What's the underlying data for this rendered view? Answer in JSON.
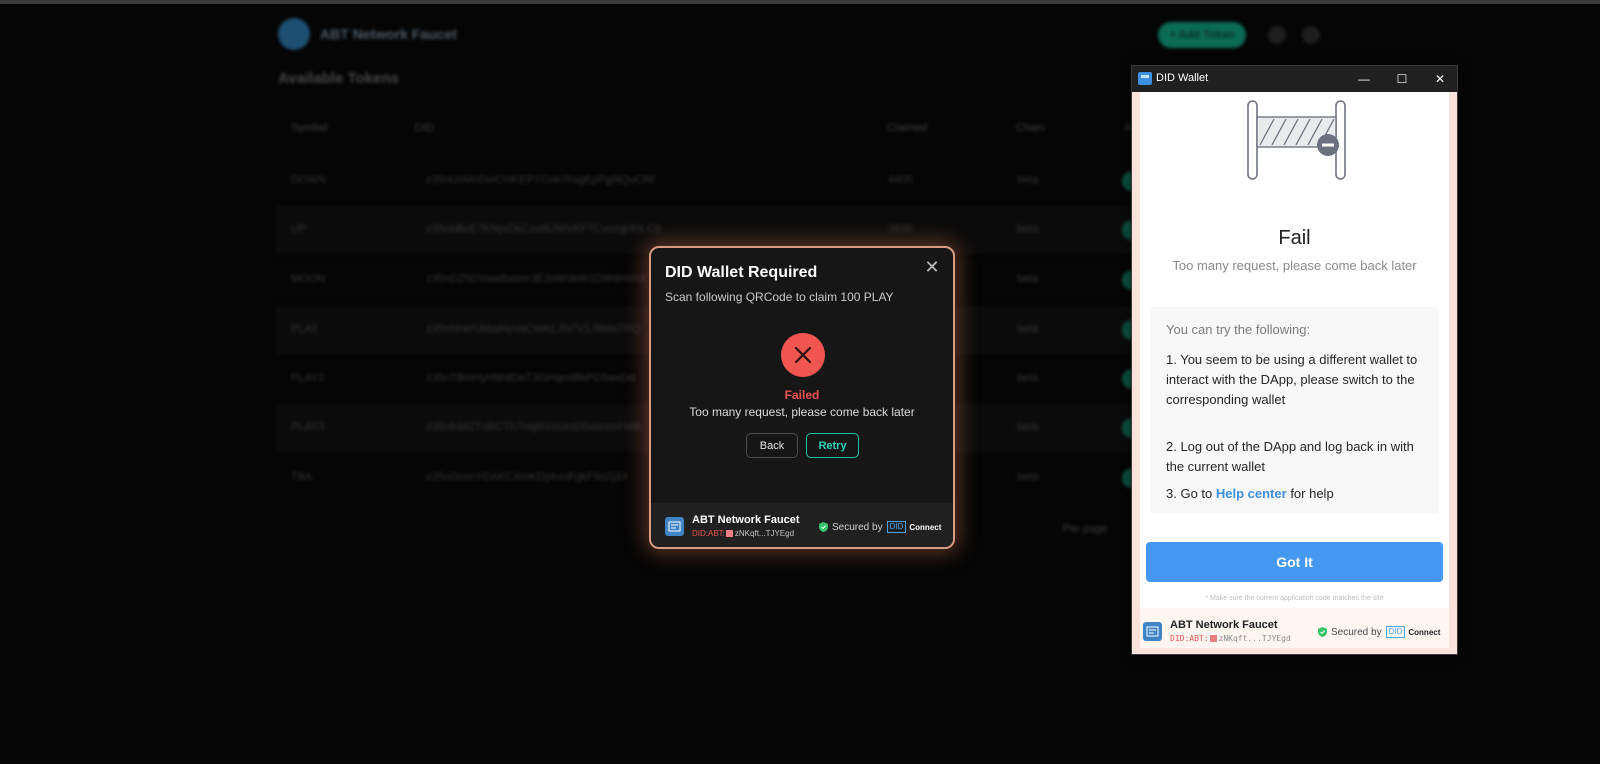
{
  "background_app": {
    "title": "ABT Network Faucet",
    "add_button": "+ Add Token",
    "section_title": "Available Tokens",
    "columns": [
      "Symbol",
      "DID",
      "Claimed",
      "Chain",
      "A"
    ],
    "rows": [
      {
        "symbol": "DOWN",
        "did": "z35nUxMnDvrCHKEPYCnk7hsgEpPg6tQuCRf",
        "claimed": "4405",
        "chain": "beta"
      },
      {
        "symbol": "UP",
        "did": "z35nbBeE7KNprDkCzwBJWVKF7CvozgHHLC9",
        "claimed": "2835",
        "chain": "beta"
      },
      {
        "symbol": "MOON",
        "did": "z35nDZ5DVwe8xomrJEJoWVeW1D9htHXhX",
        "claimed": "",
        "chain": "beta"
      },
      {
        "symbol": "PLAY",
        "did": "z35nNnerUkbaNyVaCWKLJN7V1J9MaTRQ",
        "claimed": "",
        "chain": "beta"
      },
      {
        "symbol": "PLAY2",
        "did": "z35nTBmHyH9NtDeT3GHqn4BkPD5wxDd",
        "claimed": "",
        "chain": "beta"
      },
      {
        "symbol": "PLAY3",
        "did": "z35nfnMZTnBCTh7HqNVnUmD5wxnmFMB",
        "claimed": "",
        "chain": "beta"
      },
      {
        "symbol": "TBA",
        "did": "z35nGccnYDAKCXmKDpkvuFgkF5oZj3X",
        "claimed": "",
        "chain": "beta"
      }
    ],
    "per_page": "Per page"
  },
  "dialog": {
    "title": "DID Wallet Required",
    "subtitle": "Scan following QRCode to claim 100 PLAY",
    "status": "Failed",
    "message": "Too many request, please come back later",
    "back_label": "Back",
    "retry_label": "Retry",
    "footer": {
      "app_name": "ABT Network Faucet",
      "did_prefix": "DID:ABT:",
      "did_short": "zNKqft...TJYEgd",
      "secured_by": "Secured by",
      "did_badge": "DID",
      "connect": "Connect"
    }
  },
  "wallet": {
    "window_title": "DID Wallet",
    "controls": {
      "minimize": "—",
      "maximize": "☐",
      "close": "✕"
    },
    "fail_title": "Fail",
    "fail_subtitle": "Too many request, please come back later",
    "tips_header": "You can try the following:",
    "tips": [
      "1. You seem to be using a different wallet to interact with the DApp, please switch to the corresponding wallet",
      "2. Log out of the DApp and log back in with the current wallet"
    ],
    "tip3_prefix": "3. Go to",
    "help_link": "Help center",
    "tip3_suffix": "for help",
    "got_it": "Got It",
    "hint": "* Make sure the current application code matches the site",
    "footer": {
      "app_name": "ABT Network Faucet",
      "did_prefix": "DID:ABT:",
      "did_short": "zNKqft...TJYEgd",
      "secured_by": "Secured by",
      "did_badge": "DID",
      "connect": "Connect"
    }
  },
  "colors": {
    "fail_red": "#f0564f",
    "retry_teal": "#1bc4a6",
    "link_blue": "#3d8fe0",
    "primary_blue": "#4598f0"
  }
}
